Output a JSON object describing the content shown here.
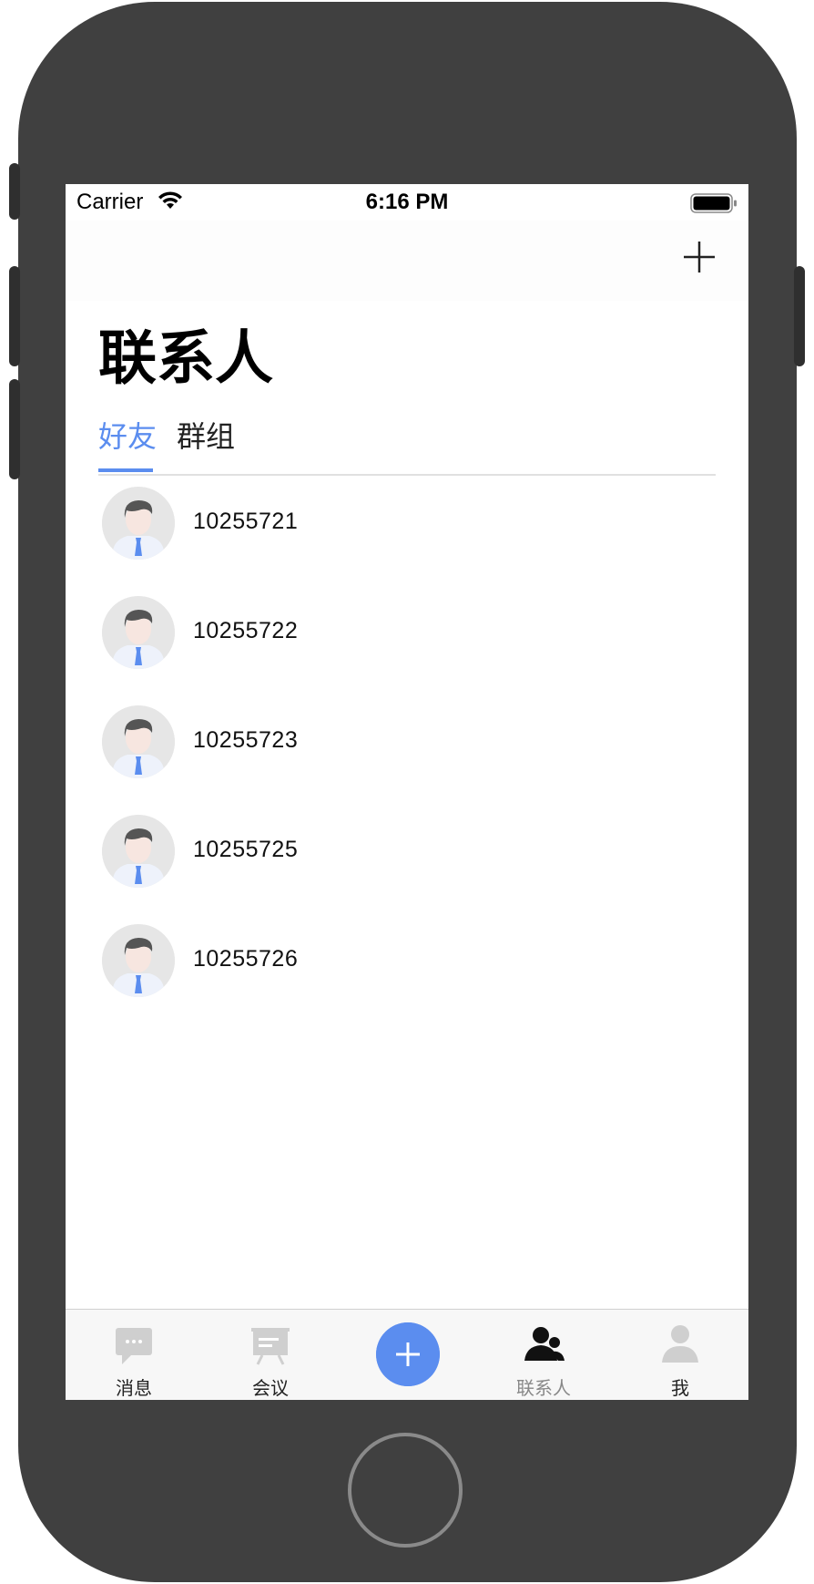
{
  "status_bar": {
    "carrier": "Carrier",
    "time": "6:16 PM"
  },
  "nav": {
    "add_icon": "plus-icon"
  },
  "page": {
    "title": "联系人"
  },
  "tabs": [
    {
      "label": "好友",
      "active": true
    },
    {
      "label": "群组",
      "active": false
    }
  ],
  "contacts": [
    {
      "name": "10255721",
      "avatar": "default-male-avatar"
    },
    {
      "name": "10255722",
      "avatar": "default-male-avatar"
    },
    {
      "name": "10255723",
      "avatar": "default-male-avatar"
    },
    {
      "name": "10255725",
      "avatar": "default-male-avatar"
    },
    {
      "name": "10255726",
      "avatar": "default-male-avatar"
    }
  ],
  "tab_bar": {
    "items": [
      {
        "label": "消息",
        "icon": "chat-bubble-icon"
      },
      {
        "label": "会议",
        "icon": "presentation-board-icon"
      },
      {
        "label": "",
        "icon": "plus-icon"
      },
      {
        "label": "联系人",
        "icon": "contacts-icon",
        "active": true
      },
      {
        "label": "我",
        "icon": "person-icon"
      }
    ]
  },
  "colors": {
    "accent": "#5b8def",
    "phone_frame": "#404040",
    "tab_bar_bg": "#f7f7f7"
  }
}
